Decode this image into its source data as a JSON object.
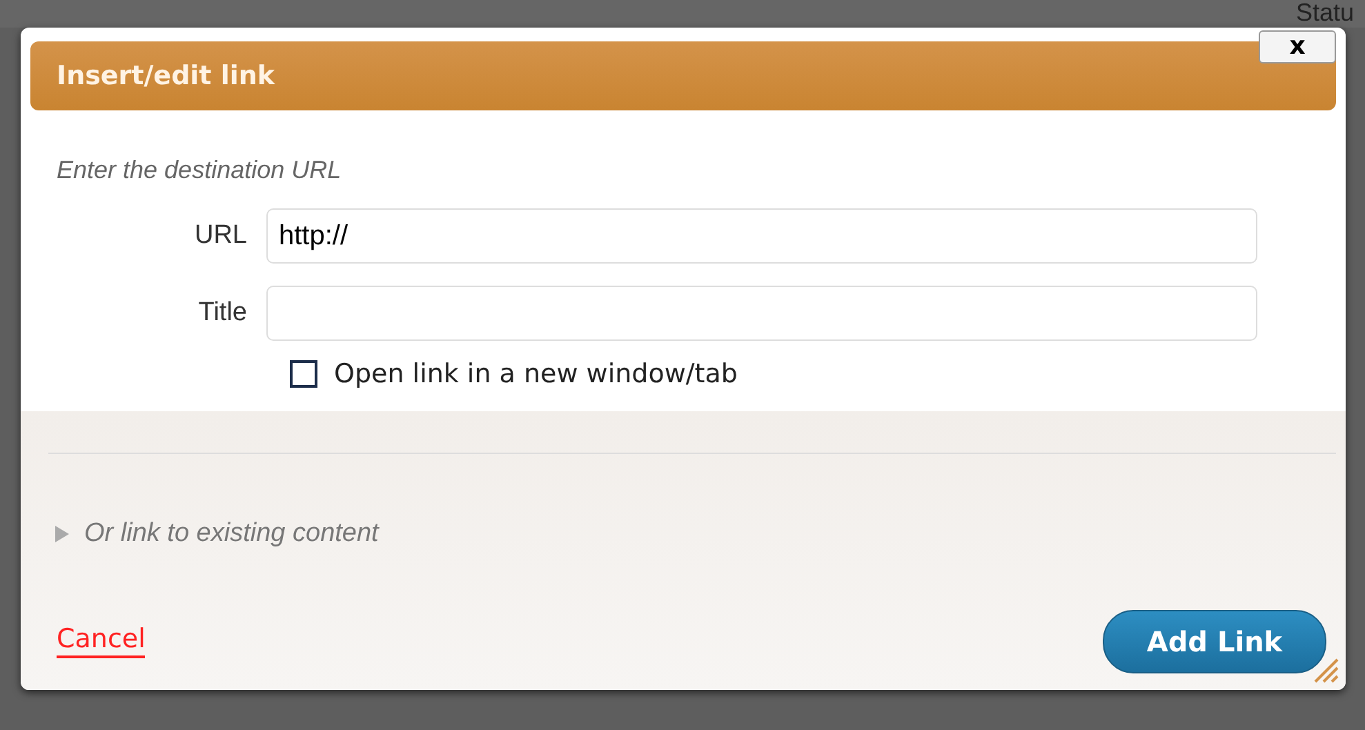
{
  "background": {
    "status_label": "Statu"
  },
  "dialog": {
    "title": "Insert/edit link",
    "close_label": "x"
  },
  "intro": "Enter the destination URL",
  "fields": [
    {
      "label": "URL",
      "value": "http://"
    },
    {
      "label": "Title"
    }
  ],
  "new_window": {
    "label": "Open link in a new window/tab",
    "checked": false
  },
  "existing_content": {
    "label": "Or link to existing content",
    "expanded": false
  },
  "buttons": {
    "cancel": "Cancel",
    "submit": "Add Link"
  }
}
